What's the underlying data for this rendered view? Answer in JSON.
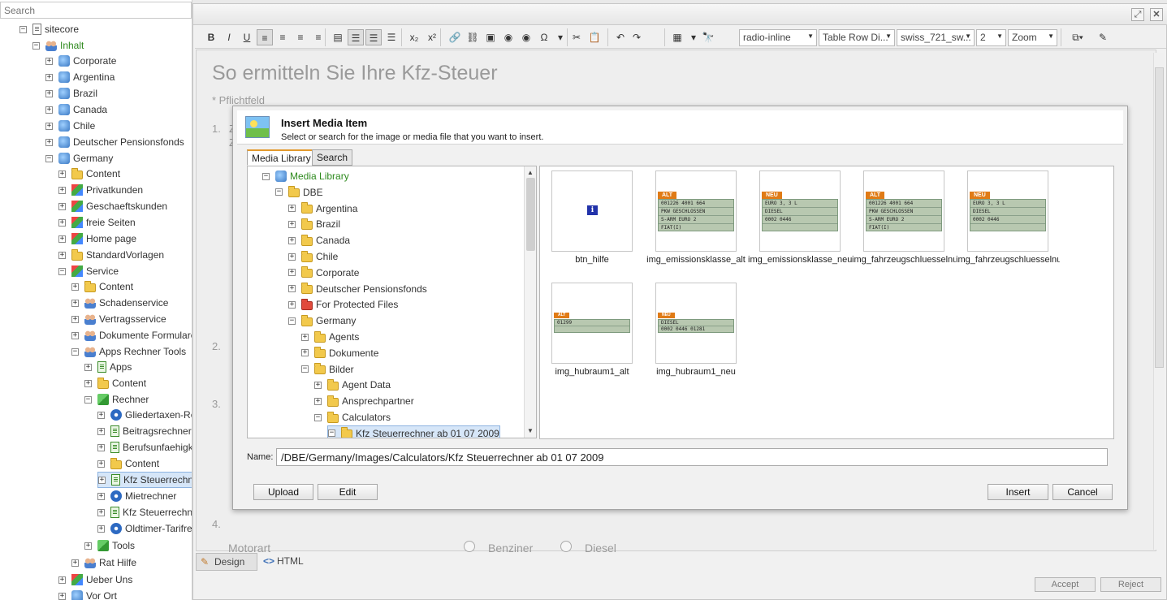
{
  "left_tree": {
    "search_placeholder": "Search",
    "items": [
      {
        "label": "sitecore",
        "exp": "−",
        "icon": "doc",
        "color": "normal"
      },
      {
        "label": "Inhalt",
        "exp": "−",
        "icon": "people",
        "color": "green"
      },
      {
        "label": "Corporate",
        "exp": "+",
        "icon": "site"
      },
      {
        "label": "Argentina",
        "exp": "+",
        "icon": "site"
      },
      {
        "label": "Brazil",
        "exp": "+",
        "icon": "site"
      },
      {
        "label": "Canada",
        "exp": "+",
        "icon": "site"
      },
      {
        "label": "Chile",
        "exp": "+",
        "icon": "site"
      },
      {
        "label": "Deutscher Pensionsfonds",
        "exp": "+",
        "icon": "site"
      },
      {
        "label": "Germany",
        "exp": "−",
        "icon": "site"
      },
      {
        "label": "Content",
        "exp": "+",
        "icon": "folder"
      },
      {
        "label": "Privatkunden",
        "exp": "+",
        "icon": "cube"
      },
      {
        "label": "Geschaeftskunden",
        "exp": "+",
        "icon": "cube"
      },
      {
        "label": "freie Seiten",
        "exp": "+",
        "icon": "cube"
      },
      {
        "label": "Home page",
        "exp": "+",
        "icon": "cube"
      },
      {
        "label": "StandardVorlagen",
        "exp": "+",
        "icon": "folder"
      },
      {
        "label": "Service",
        "exp": "−",
        "icon": "cube"
      },
      {
        "label": "Content",
        "exp": "+",
        "icon": "folder"
      },
      {
        "label": "Schadenservice",
        "exp": "+",
        "icon": "people"
      },
      {
        "label": "Vertragsservice",
        "exp": "+",
        "icon": "people"
      },
      {
        "label": "Dokumente Formulare",
        "exp": "+",
        "icon": "people"
      },
      {
        "label": "Apps Rechner Tools",
        "exp": "−",
        "icon": "people"
      },
      {
        "label": "Apps",
        "exp": "+",
        "icon": "greendoc"
      },
      {
        "label": "Content",
        "exp": "+",
        "icon": "folder"
      },
      {
        "label": "Rechner",
        "exp": "−",
        "icon": "gcube"
      },
      {
        "label": "Gliedertaxen-Rec",
        "exp": "+",
        "icon": "gear"
      },
      {
        "label": "Beitragsrechner",
        "exp": "+",
        "icon": "greendoc"
      },
      {
        "label": "Berufsunfaehigke",
        "exp": "+",
        "icon": "greendoc"
      },
      {
        "label": "Content",
        "exp": "+",
        "icon": "folder"
      },
      {
        "label": "Kfz Steuerrechne",
        "exp": "+",
        "icon": "greendoc",
        "selected": true
      },
      {
        "label": "Mietrechner",
        "exp": "+",
        "icon": "gear"
      },
      {
        "label": "Kfz Steuerrechne",
        "exp": "+",
        "icon": "greendoc"
      },
      {
        "label": "Oldtimer-Tarifrec",
        "exp": "+",
        "icon": "gear"
      },
      {
        "label": "Tools",
        "exp": "+",
        "icon": "gcube"
      },
      {
        "label": "Rat Hilfe",
        "exp": "+",
        "icon": "people"
      },
      {
        "label": "Ueber Uns",
        "exp": "+",
        "icon": "cube"
      },
      {
        "label": "Vor Ort",
        "exp": "+",
        "icon": "site"
      }
    ]
  },
  "toolbar": {
    "buttons": [
      "B",
      "I",
      "U",
      "≡",
      "≡",
      "≡",
      "≡",
      "▤",
      "☰",
      "☰",
      "☰",
      "x₂",
      "x²",
      "🔗",
      "⛓",
      "▣",
      "◉",
      "◉",
      "Ω",
      "▾",
      "✂",
      "📋",
      "↶",
      "↷",
      "▦",
      "▾",
      "🔭"
    ],
    "style_select": "radio-inline",
    "class_select": "Table Row Di...",
    "font_select": "swiss_721_sw...",
    "size_select": "2",
    "zoom_select": "Zoom"
  },
  "editor": {
    "heading": "So ermitteln Sie Ihre Kfz-Steuer",
    "required_note": "* Pflichtfeld",
    "step1": "1.",
    "step1_text": "Z",
    "step1_text2": "Z",
    "step2": "2.",
    "step3": "3.",
    "step4": "4.",
    "motorart_label": "Motorart",
    "benziner": "Benziner",
    "diesel": "Diesel",
    "mode_design": "Design",
    "mode_html": "HTML",
    "accept": "Accept",
    "reject": "Reject"
  },
  "dialog": {
    "title": "Insert Media Item",
    "subtitle": "Select or search for the image or media file that you want to insert.",
    "tabs": [
      "Media Library",
      "Search"
    ],
    "tree": [
      {
        "label": "Media Library",
        "exp": "−",
        "icon": "mediaimg",
        "green": true
      },
      {
        "label": "DBE",
        "exp": "−",
        "icon": "folder"
      },
      {
        "label": "Argentina",
        "exp": "+",
        "icon": "folder"
      },
      {
        "label": "Brazil",
        "exp": "+",
        "icon": "folder"
      },
      {
        "label": "Canada",
        "exp": "+",
        "icon": "folder"
      },
      {
        "label": "Chile",
        "exp": "+",
        "icon": "folder"
      },
      {
        "label": "Corporate",
        "exp": "+",
        "icon": "folder"
      },
      {
        "label": "Deutscher Pensionsfonds",
        "exp": "+",
        "icon": "folder"
      },
      {
        "label": "For Protected Files",
        "exp": "+",
        "icon": "redfolder"
      },
      {
        "label": "Germany",
        "exp": "−",
        "icon": "folder"
      },
      {
        "label": "Agents",
        "exp": "+",
        "icon": "folder"
      },
      {
        "label": "Dokumente",
        "exp": "+",
        "icon": "folder"
      },
      {
        "label": "Bilder",
        "exp": "−",
        "icon": "folder"
      },
      {
        "label": "Agent Data",
        "exp": "+",
        "icon": "folder"
      },
      {
        "label": "Ansprechpartner",
        "exp": "+",
        "icon": "folder"
      },
      {
        "label": "Calculators",
        "exp": "−",
        "icon": "folder"
      },
      {
        "label": "Kfz Steuerrechner ab 01 07 2009",
        "exp": "−",
        "icon": "folder",
        "selected": true
      }
    ],
    "items": [
      {
        "label": "btn_hilfe",
        "kind": "info"
      },
      {
        "label": "img_emissionsklasse_alt",
        "kind": "plate",
        "tag": "ALT",
        "lines": [
          "001226 4001 664",
          "PKW GESCHLOSSEN",
          "S-ARM EURO 2",
          "FIAT(I)"
        ]
      },
      {
        "label": "img_emissionsklasse_neu",
        "kind": "plate",
        "tag": "NEU",
        "lines": [
          "EURO 3, 3 L",
          "DIESEL",
          "0002    0446"
        ]
      },
      {
        "label": "img_fahrzeugschluesselnu",
        "kind": "plate",
        "tag": "ALT",
        "lines": [
          "001226 4001 664",
          "PKW GESCHLOSSEN",
          "S-ARM EURO 2",
          "FIAT(I)"
        ]
      },
      {
        "label": "img_fahrzeugschluesselnu",
        "kind": "plate",
        "tag": "NEU",
        "lines": [
          "EURO 3, 3 L",
          "DIESEL",
          "0002  0446"
        ]
      },
      {
        "label": "img_hubraum1_alt",
        "kind": "strip",
        "tag": "ALT",
        "lines": [
          "01299"
        ]
      },
      {
        "label": "img_hubraum1_neu",
        "kind": "strip",
        "tag": "NEU",
        "lines": [
          "DIESEL",
          "0002 0446 01281"
        ]
      }
    ],
    "name_label": "Name:",
    "name_value": "/DBE/Germany/Images/Calculators/Kfz Steuerrechner ab 01 07 2009",
    "upload": "Upload",
    "edit": "Edit",
    "insert": "Insert",
    "cancel": "Cancel"
  },
  "colors": {
    "accent_orange": "#e07b16",
    "selection": "#d6e6f8",
    "green_label": "#2e8a1e"
  }
}
